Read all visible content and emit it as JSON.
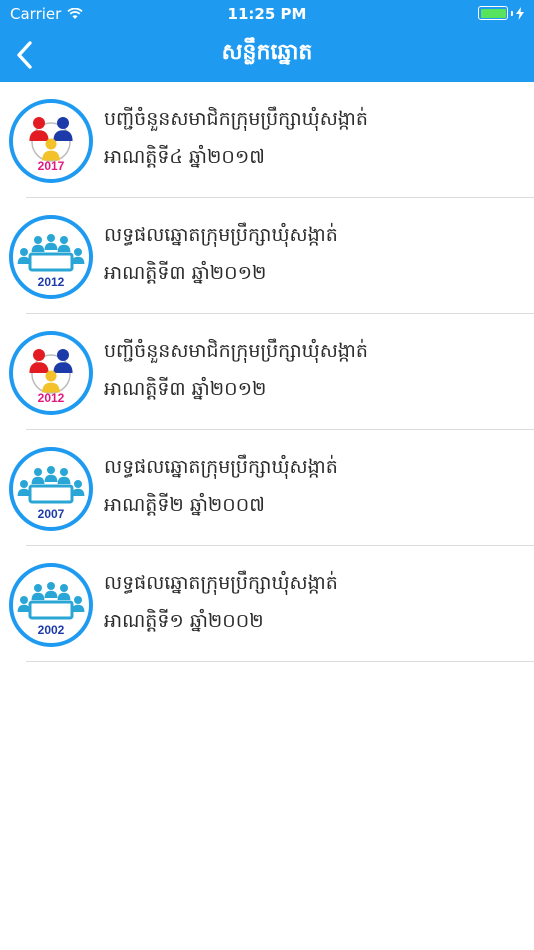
{
  "status_bar": {
    "carrier": "Carrier",
    "time": "11:25 PM",
    "battery_level": 1.0
  },
  "nav": {
    "back_icon": "chevron-left-icon",
    "title": "សន្លឹកឆ្នោត"
  },
  "colors": {
    "header": "#1e9bf0",
    "icon_ring": "#1e9bf0",
    "people_teal": "#2aa6d6",
    "people_red": "#e31b23",
    "people_blue": "#1d3ba8",
    "people_yellow": "#f3c22b",
    "year_pink": "#e2187f",
    "year_blue": "#1d3ba8"
  },
  "items": [
    {
      "icon": "members-icon",
      "year_badge": "2017",
      "line1": "បញ្ជីចំនួនសមាជិកក្រុមប្រឹក្សាឃុំសង្កាត់",
      "line2": "អាណត្តិទី៤ ឆ្នាំ២០១៧"
    },
    {
      "icon": "meeting-icon",
      "year_badge": "2012",
      "line1": "លទ្ធផលឆ្នោតក្រុមប្រឹក្សាឃុំសង្កាត់",
      "line2": "អាណត្តិទី៣ ឆ្នាំ២០១២"
    },
    {
      "icon": "members-icon",
      "year_badge": "2012",
      "line1": "បញ្ជីចំនួនសមាជិកក្រុមប្រឹក្សាឃុំសង្កាត់",
      "line2": "អាណត្តិទី៣ ឆ្នាំ២០១២"
    },
    {
      "icon": "meeting-icon",
      "year_badge": "2007",
      "line1": "លទ្ធផលឆ្នោតក្រុមប្រឹក្សាឃុំសង្កាត់",
      "line2": "អាណត្តិទី២ ឆ្នាំ២០០៧"
    },
    {
      "icon": "meeting-icon",
      "year_badge": "2002",
      "line1": "លទ្ធផលឆ្នោតក្រុមប្រឹក្សាឃុំសង្កាត់",
      "line2": "អាណត្តិទី១ ឆ្នាំ២០០២"
    }
  ]
}
